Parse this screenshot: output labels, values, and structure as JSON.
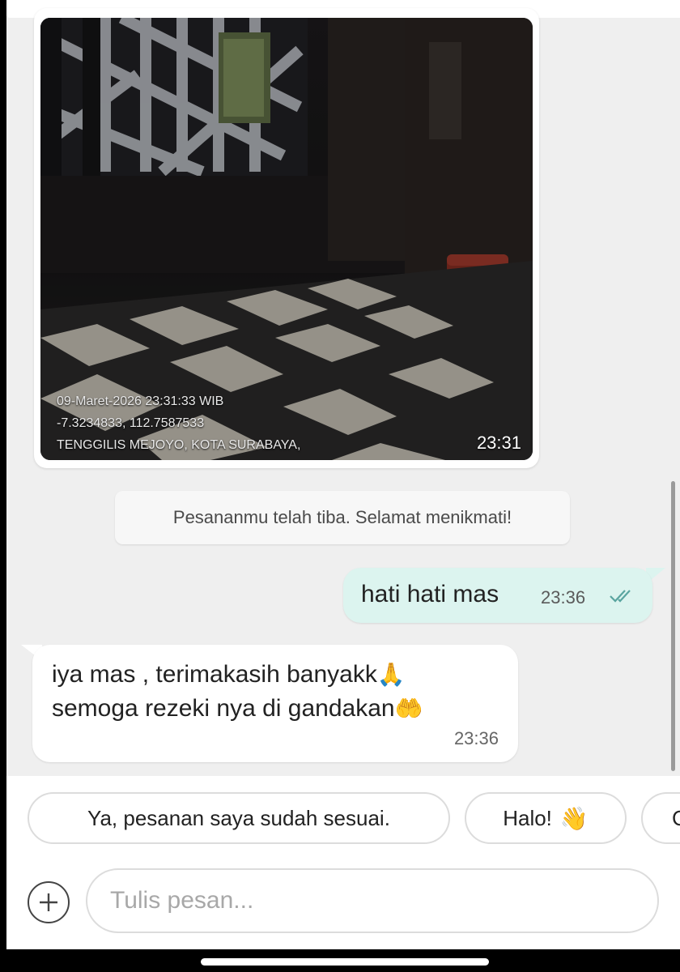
{
  "image_message": {
    "stamp_date": "09-Maret-2026 23:31:33 WIB",
    "stamp_coords": "-7.3234833, 112.7587533",
    "stamp_location": "TENGGILIS MEJOYO, KOTA SURABAYA,",
    "time": "23:31"
  },
  "system_message": {
    "text": "Pesananmu telah tiba. Selamat menikmati!"
  },
  "outgoing_message": {
    "text": "hati hati mas",
    "time": "23:36",
    "status_icon": "double-check-icon"
  },
  "incoming_message": {
    "line1": "iya mas , terimakasih banyakk",
    "emoji1": "🙏",
    "line2": "semoga rezeki nya di gandakan",
    "emoji2": "🤲",
    "time": "23:36"
  },
  "quick_replies": [
    {
      "label": "Ya, pesanan saya sudah sesuai.",
      "emoji": ""
    },
    {
      "label": "Halo!",
      "emoji": "👋"
    },
    {
      "label": "C",
      "emoji": ""
    }
  ],
  "composer": {
    "placeholder": "Tulis pesan...",
    "add_icon": "plus-circle-icon"
  },
  "colors": {
    "outgoing_bubble": "#dcf4ef",
    "incoming_bubble": "#ffffff",
    "background": "#efefef",
    "check_color": "#5aa5a0"
  }
}
